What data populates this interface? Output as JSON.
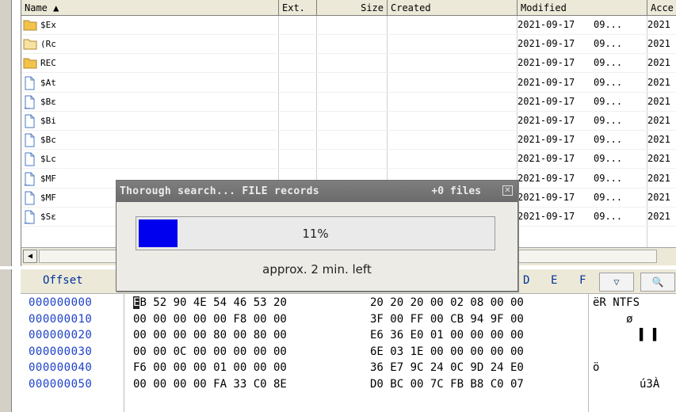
{
  "file_table": {
    "columns": [
      "Name ▲",
      "Ext.",
      "Size",
      "Created",
      "Modified",
      "Acce"
    ],
    "rows": [
      {
        "name": "$Ex",
        "icon": "folder-icon",
        "modified_date": "2021-09-17",
        "modified_time": "09...",
        "accessed": "2021"
      },
      {
        "name": "(Rc",
        "icon": "folder-light-icon",
        "modified_date": "2021-09-17",
        "modified_time": "09...",
        "accessed": "2021"
      },
      {
        "name": "REC",
        "icon": "folder-icon",
        "modified_date": "2021-09-17",
        "modified_time": "09...",
        "accessed": "2021"
      },
      {
        "name": "$At",
        "icon": "file-icon",
        "modified_date": "2021-09-17",
        "modified_time": "09...",
        "accessed": "2021"
      },
      {
        "name": "$Bε",
        "icon": "file-dotted-icon",
        "modified_date": "2021-09-17",
        "modified_time": "09...",
        "accessed": "2021"
      },
      {
        "name": "$Bi",
        "icon": "file-icon",
        "modified_date": "2021-09-17",
        "modified_time": "09...",
        "accessed": "2021"
      },
      {
        "name": "$Bc",
        "icon": "file-icon",
        "modified_date": "2021-09-17",
        "modified_time": "09...",
        "accessed": "2021"
      },
      {
        "name": "$Lc",
        "icon": "file-icon",
        "modified_date": "2021-09-17",
        "modified_time": "09...",
        "accessed": "2021"
      },
      {
        "name": "$MF",
        "icon": "file-dotted-icon",
        "modified_date": "2021-09-17",
        "modified_time": "09...",
        "accessed": "2021"
      },
      {
        "name": "$MF",
        "icon": "file-icon",
        "modified_date": "2021-09-17",
        "modified_time": "09...",
        "accessed": "2021"
      },
      {
        "name": "$Sε",
        "icon": "file-dotted-icon",
        "modified_date": "2021-09-17",
        "modified_time": "09...",
        "accessed": "2021"
      }
    ]
  },
  "hex_view": {
    "offset_header": "Offset",
    "col_headers": [
      "D",
      "E",
      "F"
    ],
    "rows": [
      {
        "offset": "000000000",
        "left": "EB 52 90 4E 54 46 53 20",
        "right": "20 20 20 00 02 08 00 00",
        "ascii": "ëR NTFS"
      },
      {
        "offset": "000000010",
        "left": "00 00 00 00 00 F8 00 00",
        "right": "3F 00 FF 00 CB 94 9F 00",
        "ascii": "     ø"
      },
      {
        "offset": "000000020",
        "left": "00 00 00 00 80 00 80 00",
        "right": "E6 36 E0 01 00 00 00 00",
        "ascii": "       ▌ ▌"
      },
      {
        "offset": "000000030",
        "left": "00 00 0C 00 00 00 00 00",
        "right": "6E 03 1E 00 00 00 00 00",
        "ascii": ""
      },
      {
        "offset": "000000040",
        "left": "F6 00 00 00 01 00 00 00",
        "right": "36 E7 9C 24 0C 9D 24 E0",
        "ascii": "ö"
      },
      {
        "offset": "000000050",
        "left": "00 00 00 00 FA 33 C0 8E",
        "right": "D0 BC 00 7C FB B8 C0 07",
        "ascii": "       ú3À"
      }
    ]
  },
  "dialog": {
    "title": "Thorough search... FILE records",
    "count": "+0 files",
    "progress_text": "11%",
    "progress_fraction": 0.11,
    "eta": "approx. 2 min. left"
  },
  "colors": {
    "progress_fill": "#0000ee",
    "offset_text": "#1a3fc8",
    "header_bg": "#ece9d8"
  }
}
